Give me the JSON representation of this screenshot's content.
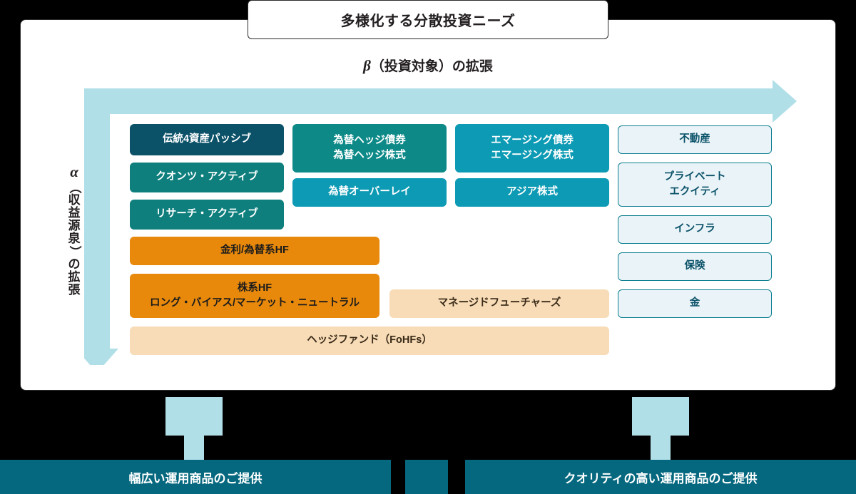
{
  "title": {
    "text": "多様化する分散投資ニーズ"
  },
  "axes": {
    "beta": {
      "glyph": "β",
      "text": "（投資対象）の拡張",
      "full": "β（投資対象）の拡張"
    },
    "alpha": {
      "glyph": "α",
      "chars": [
        "（",
        "収",
        "益",
        "源",
        "泉",
        "）",
        "の",
        "拡",
        "張"
      ],
      "full": "α（収益源泉）の拡張"
    }
  },
  "boxes": [
    {
      "id": "trad4",
      "label": "伝統4資産パッシブ",
      "style": "navy"
    },
    {
      "id": "quants-active",
      "label": "クオンツ・アクティブ",
      "style": "teal"
    },
    {
      "id": "research-active",
      "label": "リサーチ・アクティブ",
      "style": "teal"
    },
    {
      "id": "fx-hedge",
      "line1": "為替ヘッジ債券",
      "line2": "為替ヘッジ株式",
      "style": "teal2"
    },
    {
      "id": "fx-overlay",
      "label": "為替オーバーレイ",
      "style": "cyan"
    },
    {
      "id": "emerging",
      "line1": "エマージング債券",
      "line2": "エマージング株式",
      "style": "cyan"
    },
    {
      "id": "asia-equity",
      "label": "アジア株式",
      "style": "cyan"
    },
    {
      "id": "real-estate",
      "label": "不動産",
      "style": "light"
    },
    {
      "id": "private-equity",
      "line1": "プライベート",
      "line2": "エクイティ",
      "style": "light"
    },
    {
      "id": "infra",
      "label": "インフラ",
      "style": "light"
    },
    {
      "id": "insurance",
      "label": "保険",
      "style": "light"
    },
    {
      "id": "gold",
      "label": "金",
      "style": "light"
    },
    {
      "id": "rates-fx-hf",
      "label": "金利/為替系HF",
      "style": "orange"
    },
    {
      "id": "equity-hf",
      "line1": "株系HF",
      "line2": "ロング・バイアス/マーケット・ニュートラル",
      "style": "orange"
    },
    {
      "id": "managed-futures",
      "label": "マネージドフューチャーズ",
      "style": "lorange"
    },
    {
      "id": "fohfs",
      "label": "ヘッジファンド（FoHFs）",
      "style": "lorange"
    }
  ],
  "bottom": {
    "left_bar": "幅広い運用商品のご提供",
    "right_bar": "クオリティの高い運用商品のご提供"
  },
  "colors": {
    "navy": "#0b5269",
    "teal": "#0e7f7d",
    "teal2": "#0d8a88",
    "cyan": "#0d9ab4",
    "orange": "#e8890c",
    "light_orange": "#f7dcb7",
    "light_blue_box": "#eaf4f8",
    "arrow_blue": "#b1dfe8",
    "bottom_bar": "#05687f",
    "background": "#000000",
    "panel": "#ffffff"
  }
}
